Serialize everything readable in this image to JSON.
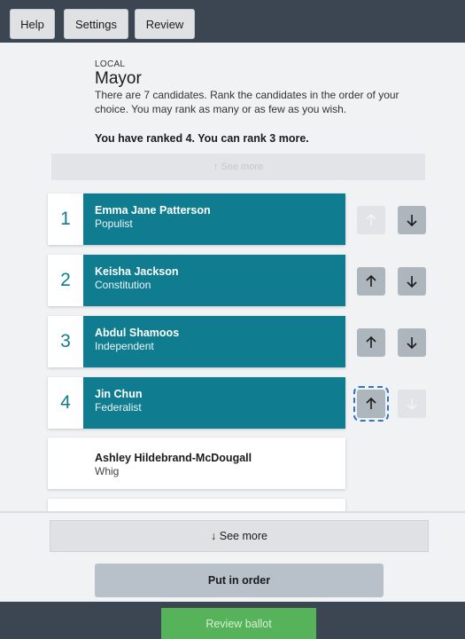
{
  "top_nav": {
    "help": "Help",
    "settings": "Settings",
    "review": "Review"
  },
  "contest": {
    "type": "LOCAL",
    "title": "Mayor",
    "instructions": "There are 7 candidates. Rank the candidates in the order of your choice. You may rank as many or as few as you wish.",
    "rank_status": "You have ranked 4. You can rank 3 more.",
    "see_more_top": "↑ See more"
  },
  "ranked": [
    {
      "rank": "1",
      "name": "Emma Jane Patterson",
      "party": "Populist",
      "up_enabled": false,
      "down_enabled": true
    },
    {
      "rank": "2",
      "name": "Keisha Jackson",
      "party": "Constitution",
      "up_enabled": true,
      "down_enabled": true
    },
    {
      "rank": "3",
      "name": "Abdul Shamoos",
      "party": "Independent",
      "up_enabled": true,
      "down_enabled": true
    },
    {
      "rank": "4",
      "name": "Jin Chun",
      "party": "Federalist",
      "up_enabled": true,
      "down_enabled": false,
      "up_focused": true
    }
  ],
  "unranked": [
    {
      "name": "Ashley Hildebrand-McDougall",
      "party": "Whig"
    }
  ],
  "see_more_bottom": "↓ See more",
  "put_in_order": "Put in order",
  "review_ballot": "Review ballot",
  "colors": {
    "ranked_teal": "#0f7d8f",
    "nav_bar": "#3b4652",
    "review_green": "#56b35a",
    "focus_outline": "#2f74d0"
  },
  "icons": {
    "up": "arrow-up-icon",
    "down": "arrow-down-icon"
  }
}
